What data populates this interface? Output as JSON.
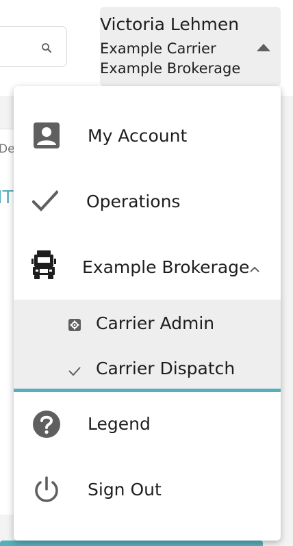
{
  "header": {
    "search": {
      "value": "",
      "placeholder": "",
      "icon": "search-icon"
    },
    "user": {
      "name": "Victoria Lehmen",
      "carrier": "Example Carrier",
      "brokerage": "Example Brokerage",
      "caret_icon": "caret-up-icon"
    }
  },
  "background": {
    "column_label": "De",
    "row_code": "IT"
  },
  "menu": {
    "items": [
      {
        "label": "My Account",
        "icon": "account-box-icon"
      },
      {
        "label": "Operations",
        "icon": "check-icon"
      },
      {
        "label": "Example Brokerage",
        "icon": "truck-icon",
        "expanded": true
      }
    ],
    "submenu": [
      {
        "label": "Carrier Admin",
        "icon": "settings-box-icon"
      },
      {
        "label": "Carrier Dispatch",
        "icon": "check-icon",
        "active": true
      }
    ],
    "footer_items": [
      {
        "label": "Legend",
        "icon": "help-circle-icon"
      },
      {
        "label": "Sign Out",
        "icon": "power-icon"
      }
    ]
  },
  "colors": {
    "accent": "#56aebb",
    "icon_dark": "#5f5f5f",
    "submenu_bg": "#eeeeee",
    "user_menu_bg": "#eeeeee"
  }
}
